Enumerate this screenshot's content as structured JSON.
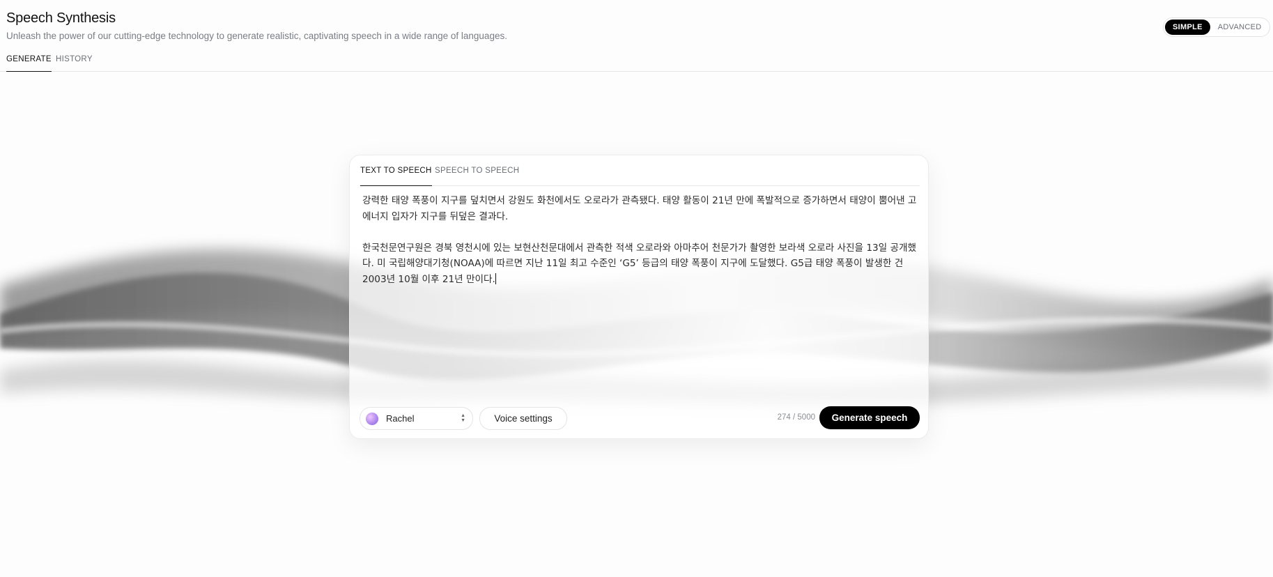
{
  "header": {
    "title": "Speech Synthesis",
    "subtitle": "Unleash the power of our cutting-edge technology to generate realistic, captivating speech in a wide range of languages."
  },
  "mode_toggle": {
    "simple": "SIMPLE",
    "advanced": "ADVANCED",
    "selected": "SIMPLE"
  },
  "top_tabs": {
    "generate": "GENERATE",
    "history": "HISTORY",
    "selected": "GENERATE"
  },
  "card": {
    "tabs": {
      "tts": "TEXT TO SPEECH",
      "sts": "SPEECH TO SPEECH",
      "selected": "TEXT TO SPEECH"
    },
    "text": "강력한 태양 폭풍이 지구를 덮치면서 강원도 화천에서도 오로라가 관측됐다. 태양 활동이 21년 만에 폭발적으로 증가하면서 태양이 뿜어낸 고에너지 입자가 지구를 뒤덮은 결과다.\n\n한국천문연구원은 경북 영천시에 있는 보현산천문대에서 관측한 적색 오로라와 아마추어 천문가가 촬영한 보라색 오로라 사진을 13일 공개했다. 미 국립해양대기청(NOAA)에 따르면 지난 11일 최고 수준인 ‘G5’ 등급의 태양 폭풍이 지구에 도달했다. G5급 태양 폭풍이 발생한 건 2003년 10월 이후 21년 만이다.",
    "voice": {
      "name": "Rachel"
    },
    "voice_settings_label": "Voice settings",
    "char_count": "274 / 5000",
    "generate_label": "Generate speech"
  },
  "colors": {
    "accent": "#000000",
    "muted_text": "#7a7d85",
    "border": "#e3e4e7"
  },
  "icons": {
    "voice_avatar": "gradient-avatar-icon",
    "select_arrows": "chevron-up-down-icon"
  }
}
